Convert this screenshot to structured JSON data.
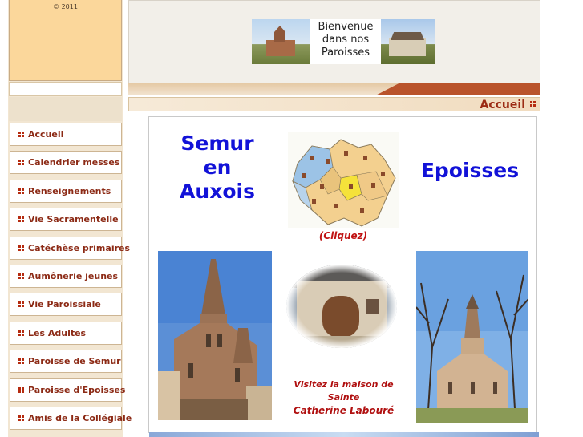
{
  "copyright": "© 2011",
  "header": {
    "banner_lines": [
      "Bienvenue",
      "dans nos",
      "Paroisses"
    ]
  },
  "page_title": "Accueil",
  "nav": {
    "items": [
      {
        "label": "Accueil"
      },
      {
        "label": "Calendrier messes"
      },
      {
        "label": "Renseignements"
      },
      {
        "label": "Vie Sacramentelle"
      },
      {
        "label": "Catéchèse primaires"
      },
      {
        "label": "Aumônerie jeunes"
      },
      {
        "label": "Vie Paroissiale"
      },
      {
        "label": "Les Adultes"
      },
      {
        "label": "Paroisse de Semur"
      },
      {
        "label": "Paroisse d'Epoisses"
      },
      {
        "label": "Amis de la Collégiale"
      }
    ]
  },
  "content": {
    "semur": [
      "Semur",
      "en",
      "Auxois"
    ],
    "epoisses": "Epoisses",
    "map_caption": "(Cliquez)",
    "visit_line1": "Visitez la maison de",
    "visit_line2": "Sainte",
    "visit_name": "Catherine Labouré"
  },
  "colors": {
    "nav_text": "#8c2a15",
    "link_blue": "#1212d8",
    "caption_red": "#b01010",
    "accent_orange": "#b9532b"
  }
}
